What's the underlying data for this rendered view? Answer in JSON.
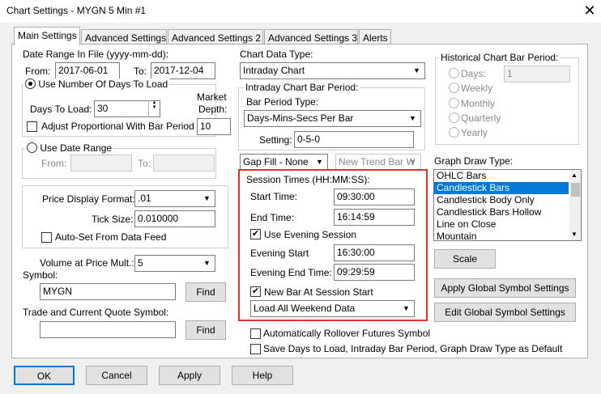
{
  "window": {
    "title": "Chart Settings - MYGN  5 Min  #1",
    "close_glyph": "✕"
  },
  "tabs": [
    "Main Settings",
    "Advanced Settings",
    "Advanced Settings 2",
    "Advanced Settings 3",
    "Alerts"
  ],
  "date_range": {
    "label": "Date Range In File (yyyy-mm-dd):",
    "from_label": "From:",
    "from_value": "2017-06-01",
    "to_label": "To:",
    "to_value": "2017-12-04"
  },
  "days_group": {
    "radio_label": "Use Number Of Days To Load",
    "days_label": "Days To Load:",
    "days_value": "30",
    "market_depth_label_1": "Market",
    "market_depth_label_2": "Depth:",
    "market_depth_value": "10",
    "adjust_label": "Adjust Proportional With Bar Period"
  },
  "date_group": {
    "radio_label": "Use Date Range",
    "from_label": "From:",
    "to_label": "To:"
  },
  "price_group": {
    "format_label": "Price Display Format:",
    "format_value": ".01",
    "tick_label": "Tick Size:",
    "tick_value": "0.010000",
    "autoset_label": "Auto-Set From Data Feed"
  },
  "volume": {
    "label": "Volume at Price Mult.:",
    "value": "5"
  },
  "symbol": {
    "label": "Symbol:",
    "value": "MYGN",
    "find_label": "Find"
  },
  "quote_symbol": {
    "label": "Trade and Current Quote Symbol:",
    "value": "",
    "find_label": "Find"
  },
  "chart_data_type": {
    "label": "Chart Data Type:",
    "value": "Intraday Chart"
  },
  "intraday": {
    "group_label": "Intraday Chart Bar Period:",
    "period_type_label": "Bar Period Type:",
    "period_type_value": "Days-Mins-Secs Per Bar",
    "setting_label": "Setting:",
    "setting_value": "0-5-0"
  },
  "gap_fill": {
    "value": "Gap Fill - None"
  },
  "new_trend": {
    "value": "New Trend Bar W"
  },
  "session": {
    "group_label": "Session Times (HH:MM:SS):",
    "start_label": "Start Time:",
    "start_value": "09:30:00",
    "end_label": "End Time:",
    "end_value": "16:14:59",
    "evening_check_label": "Use Evening Session",
    "evening_start_label": "Evening Start",
    "evening_start_value": "16:30:00",
    "evening_end_label": "Evening End Time:",
    "evening_end_value": "09:29:59",
    "new_bar_label": "New Bar At Session Start",
    "weekend_value": "Load All Weekend Data"
  },
  "rollover_label": "Automatically Rollover Futures Symbol",
  "save_default_label": "Save Days to Load, Intraday Bar Period, Graph Draw Type as Default",
  "historical": {
    "group_label": "Historical Chart Bar Period:",
    "options": [
      "Days:",
      "Weekly",
      "Monthly",
      "Quarterly",
      "Yearly"
    ],
    "days_value": "1"
  },
  "graph_draw": {
    "label": "Graph Draw Type:",
    "items": [
      "OHLC Bars",
      "Candlestick Bars",
      "Candlestick Body Only",
      "Candlestick Bars Hollow",
      "Line on Close",
      "Mountain"
    ],
    "scale_label": "Scale"
  },
  "apply_global_label": "Apply Global Symbol Settings",
  "edit_global_label": "Edit Global Symbol Settings",
  "footer": {
    "ok": "OK",
    "cancel": "Cancel",
    "apply": "Apply",
    "help": "Help"
  },
  "check_glyph": "✔",
  "arrow_glyph": "▼",
  "colors": {
    "highlight": "#0078d7",
    "session_border": "#e0312b"
  }
}
